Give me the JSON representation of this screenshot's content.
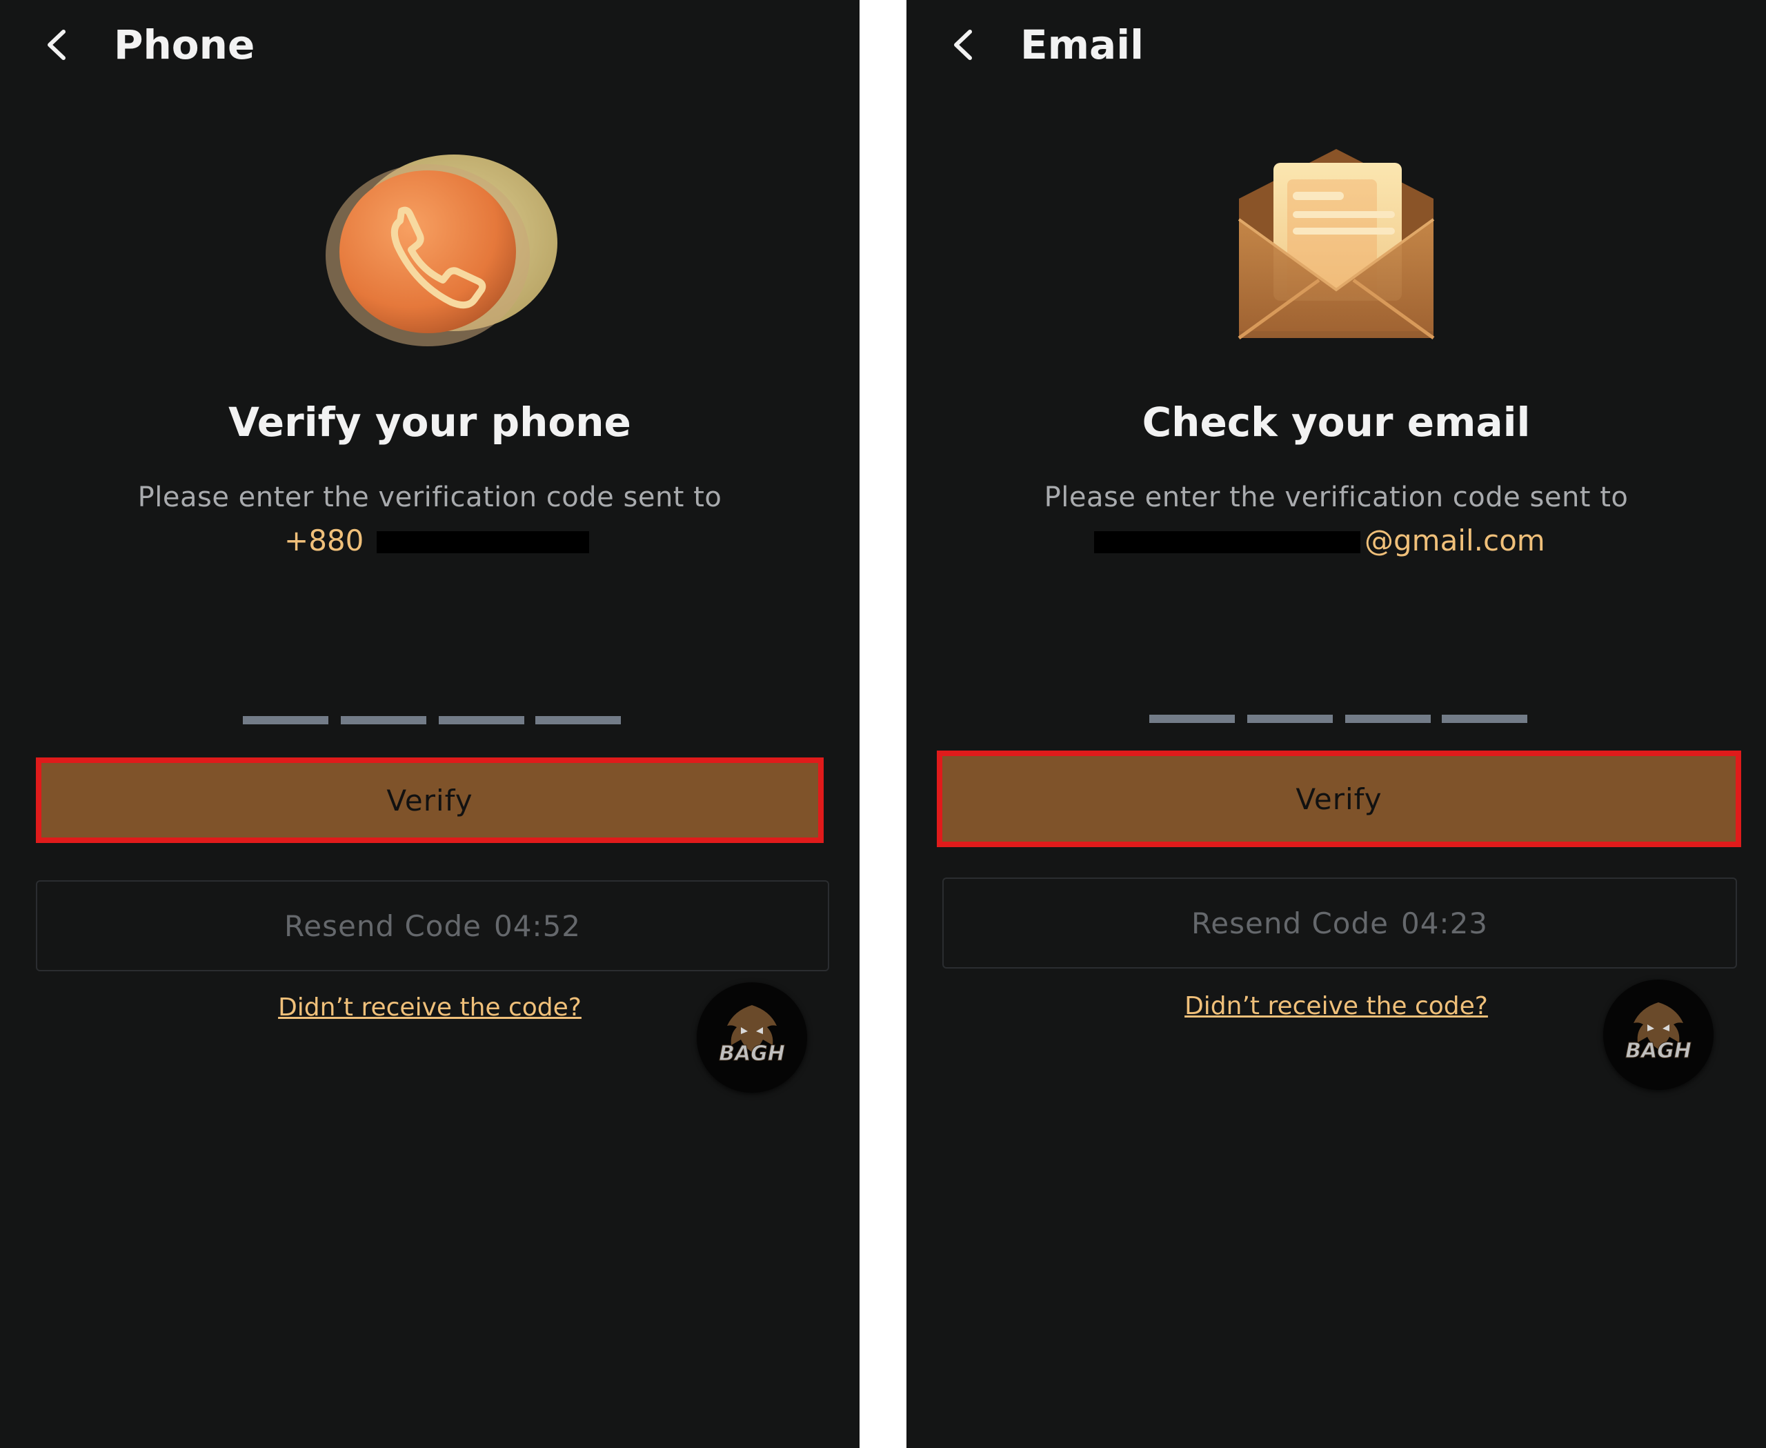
{
  "colors": {
    "background": "#141515",
    "accent": "#f0c07a",
    "verify_button": "#7f532a",
    "highlight_border": "#e01b1b",
    "otp_slot": "#737c88"
  },
  "phone_screen": {
    "header_title": "Phone",
    "back_icon": "chevron-left-icon",
    "hero_icon": "phone-icon",
    "heading": "Verify your phone",
    "instruction": "Please enter the verification code sent to",
    "target_prefix": "+880",
    "otp_slots": 4,
    "verify_label": "Verify",
    "resend_label": "Resend Code",
    "resend_timer": "04:52",
    "help_link": "Didn’t receive the code?",
    "fab_logo_text": "BAGH"
  },
  "email_screen": {
    "header_title": "Email",
    "back_icon": "chevron-left-icon",
    "hero_icon": "envelope-icon",
    "heading": "Check your email",
    "instruction": "Please enter the verification code sent to",
    "target_suffix": "@gmail.com",
    "otp_slots": 4,
    "verify_label": "Verify",
    "resend_label": "Resend Code",
    "resend_timer": "04:23",
    "help_link": "Didn’t receive the code?",
    "fab_logo_text": "BAGH"
  }
}
